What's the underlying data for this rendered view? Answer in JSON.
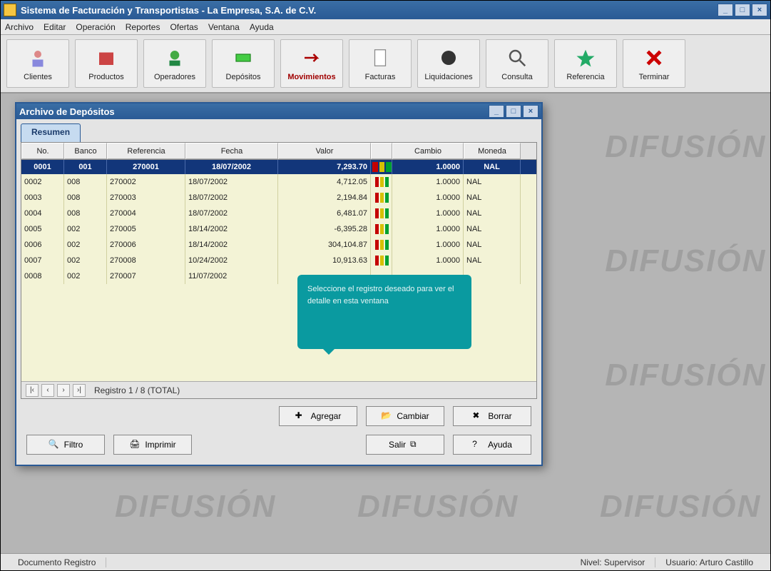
{
  "app": {
    "title": "Sistema de Facturación y Transportistas - La Empresa, S.A. de C.V.",
    "menu": [
      "Archivo",
      "Editar",
      "Operación",
      "Reportes",
      "Ofertas",
      "Ventana",
      "Ayuda"
    ],
    "toolbar": [
      {
        "label": "Clientes",
        "icon": "user"
      },
      {
        "label": "Productos",
        "icon": "box"
      },
      {
        "label": "Operadores",
        "icon": "operator"
      },
      {
        "label": "Depósitos",
        "icon": "deposit"
      },
      {
        "label": "Movimientos",
        "icon": "moves",
        "highlight": true
      },
      {
        "label": "Facturas",
        "icon": "invoice"
      },
      {
        "label": "Liquidaciones",
        "icon": "liquid"
      },
      {
        "label": "Consulta",
        "icon": "query"
      },
      {
        "label": "Referencia",
        "icon": "ref"
      },
      {
        "label": "Terminar",
        "icon": "exit"
      }
    ],
    "statusbar": {
      "left": "Documento Registro",
      "mid": "Nivel: Supervisor",
      "right": "Usuario: Arturo Castillo"
    },
    "watermarks": [
      "DIFUSIÓN  P",
      "DIFUSIÓN  P",
      "DIFUSIÓN  P"
    ]
  },
  "dialog": {
    "title": "Archivo de Depósitos",
    "tab": "Resumen",
    "columns": [
      "No.",
      "Banco",
      "Referencia",
      "Fecha",
      "Valor",
      "",
      "Cambio",
      "Moneda"
    ],
    "subhead": [
      "0001",
      "001",
      "270001",
      "18/07/2002",
      "7,293.70",
      "",
      "1.0000",
      "NAL"
    ],
    "rows": [
      {
        "no": "0002",
        "banco": "008",
        "ref": "270002",
        "fecha": "18/07/2002",
        "valor": "4,712.05",
        "ind": [
          "r",
          "y",
          "g"
        ],
        "cambio": "1.0000",
        "mon": "NAL"
      },
      {
        "no": "0003",
        "banco": "008",
        "ref": "270003",
        "fecha": "18/07/2002",
        "valor": "2,194.84",
        "ind": [
          "r",
          "y",
          "g"
        ],
        "cambio": "1.0000",
        "mon": "NAL"
      },
      {
        "no": "0004",
        "banco": "008",
        "ref": "270004",
        "fecha": "18/07/2002",
        "valor": "6,481.07",
        "ind": [
          "r",
          "y",
          "g"
        ],
        "cambio": "1.0000",
        "mon": "NAL"
      },
      {
        "no": "0005",
        "banco": "002",
        "ref": "270005",
        "fecha": "18/14/2002",
        "valor": "-6,395.28",
        "ind": [
          "r",
          "y",
          "g"
        ],
        "cambio": "1.0000",
        "mon": "NAL"
      },
      {
        "no": "0006",
        "banco": "002",
        "ref": "270006",
        "fecha": "18/14/2002",
        "valor": "304,104.87",
        "ind": [
          "r",
          "y",
          "g"
        ],
        "cambio": "1.0000",
        "mon": "NAL"
      },
      {
        "no": "0007",
        "banco": "002",
        "ref": "270008",
        "fecha": "10/24/2002",
        "valor": "10,913.63",
        "ind": [
          "r",
          "y",
          "g"
        ],
        "cambio": "1.0000",
        "mon": "NAL"
      },
      {
        "no": "0008",
        "banco": "002",
        "ref": "270007",
        "fecha": "11/07/2002",
        "valor": "",
        "ind": [],
        "cambio": "",
        "mon": ""
      }
    ],
    "nav_text": "Registro 1 / 8 (TOTAL)",
    "tooltip": "Seleccione el registro deseado para ver el detalle en esta ventana",
    "buttons": {
      "agregar": "Agregar",
      "cambiar": "Cambiar",
      "borrar": "Borrar"
    },
    "footer": {
      "filtro": "Filtro",
      "imprimir": "Imprimir",
      "salir": "Salir",
      "ayuda": "Ayuda"
    }
  }
}
